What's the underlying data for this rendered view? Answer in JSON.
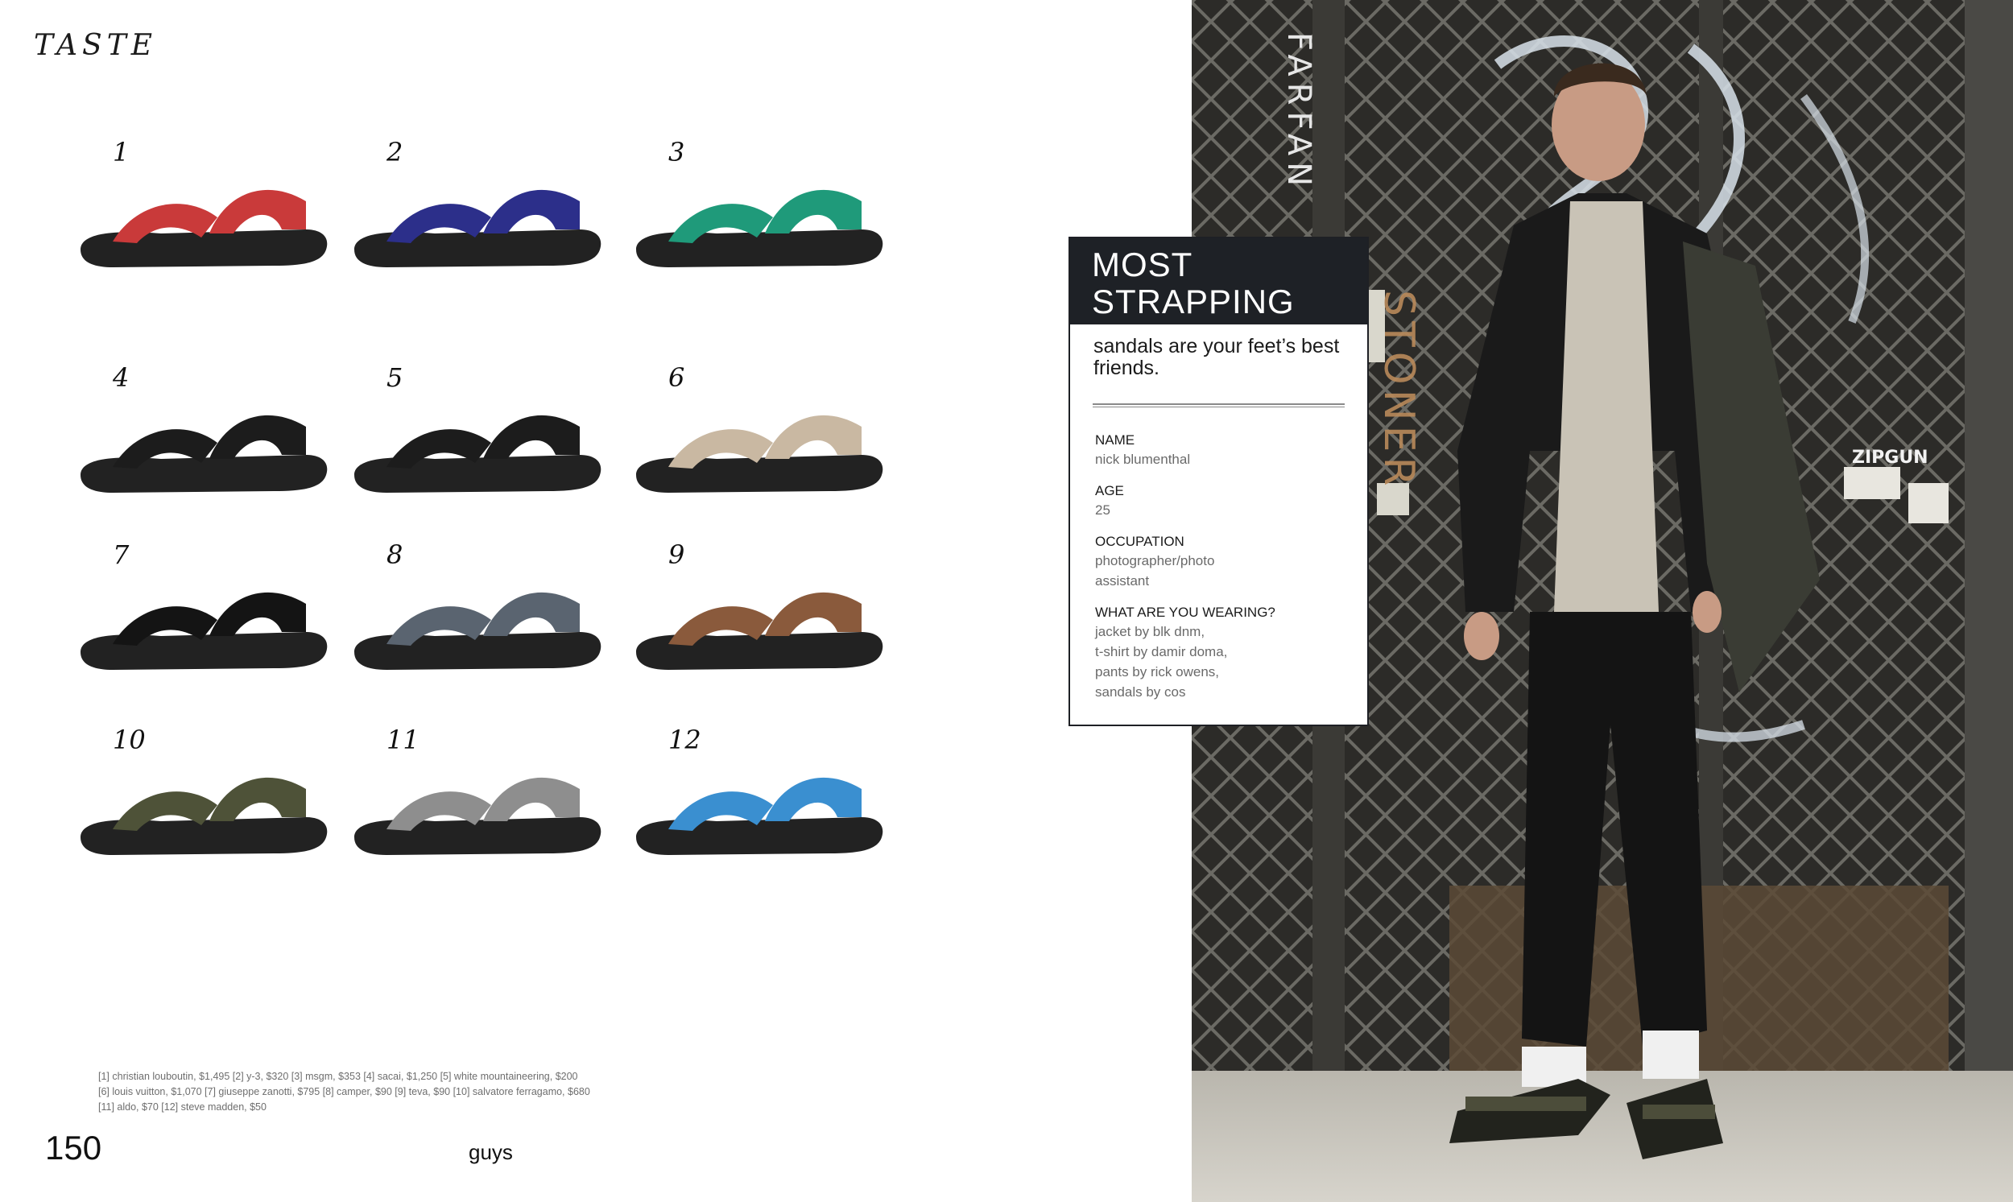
{
  "page": {
    "section_label": "TASTE",
    "page_number": "150",
    "magazine": "guys"
  },
  "products": [
    {
      "number": "1",
      "icon": "sandal-icon",
      "color": "#c93a3a"
    },
    {
      "number": "2",
      "icon": "sandal-icon",
      "color": "#2c2f8a"
    },
    {
      "number": "3",
      "icon": "sandal-icon",
      "color": "#1f9a7a"
    },
    {
      "number": "4",
      "icon": "sandal-icon",
      "color": "#1c1c1c"
    },
    {
      "number": "5",
      "icon": "sandal-icon",
      "color": "#1c1c1c"
    },
    {
      "number": "6",
      "icon": "sandal-icon",
      "color": "#c9b8a2"
    },
    {
      "number": "7",
      "icon": "sandal-icon",
      "color": "#141414"
    },
    {
      "number": "8",
      "icon": "sandal-icon",
      "color": "#5a6470"
    },
    {
      "number": "9",
      "icon": "sandal-icon",
      "color": "#8a5a3c"
    },
    {
      "number": "10",
      "icon": "sandal-icon",
      "color": "#4e5238"
    },
    {
      "number": "11",
      "icon": "sandal-icon",
      "color": "#8e8e8e"
    },
    {
      "number": "12",
      "icon": "sandal-icon",
      "color": "#3a8fd0"
    }
  ],
  "credits": [
    "[1] christian louboutin, $1,495 [2] y-3, $320 [3] msgm, $353 [4] sacai, $1,250 [5] white mountaineering, $200",
    "[6] louis vuitton, $1,070 [7] giuseppe zanotti, $795 [8] camper, $90 [9] teva, $90 [10] salvatore ferragamo, $680",
    "[11] aldo, $70 [12] steve madden, $50"
  ],
  "card": {
    "title_line1": "MOST",
    "title_line2": "STRAPPING",
    "subtitle": "sandals are your feet’s best friends.",
    "fields": [
      {
        "label": "NAME",
        "lines": [
          "nick blumenthal"
        ]
      },
      {
        "label": "AGE",
        "lines": [
          "25"
        ]
      },
      {
        "label": "OCCUPATION",
        "lines": [
          "photographer/photo",
          "assistant"
        ]
      },
      {
        "label": "WHAT ARE YOU WEARING?",
        "lines": [
          "jacket by blk dnm,",
          "t-shirt by damir doma,",
          "pants by rick owens,",
          "sandals by cos"
        ]
      }
    ]
  },
  "photo": {
    "description_icon": "portrait-photo",
    "graffiti_tags": [
      "FARFAN",
      "STONER",
      "ZIPGUN"
    ]
  }
}
